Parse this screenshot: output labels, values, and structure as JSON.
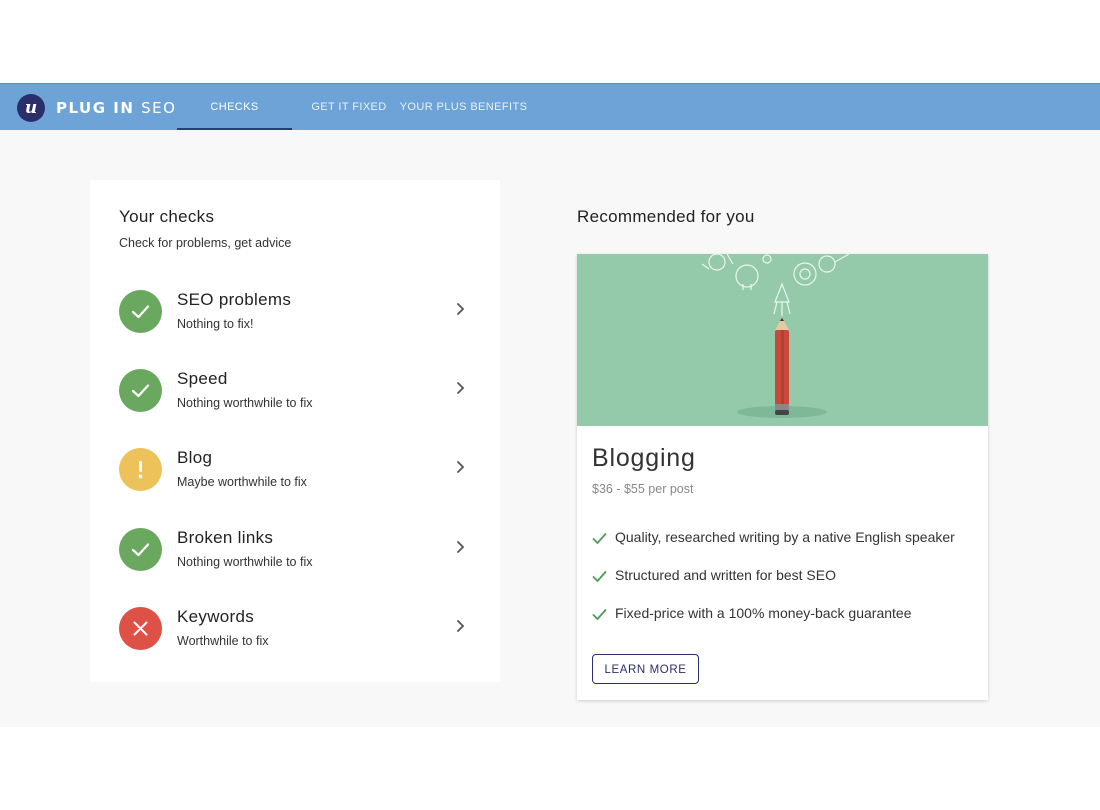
{
  "brand": {
    "logo_letter": "u",
    "name_bold": "PLUG IN",
    "name_light": "SEO",
    "color": "#2a2f6b"
  },
  "nav": {
    "bar_color": "#6da3d6",
    "tabs": [
      {
        "label": "CHECKS",
        "active": true
      },
      {
        "label": "GET IT FIXED",
        "active": false
      },
      {
        "label": "YOUR PLUS BENEFITS",
        "active": false
      }
    ]
  },
  "checks": {
    "title": "Your checks",
    "subtitle": "Check for problems, get advice",
    "items": [
      {
        "title": "SEO problems",
        "status_text": "Nothing to fix!",
        "status": "ok",
        "icon": "check-icon",
        "color": "#6aa85f"
      },
      {
        "title": "Speed",
        "status_text": "Nothing worthwhile to fix",
        "status": "ok",
        "icon": "check-icon",
        "color": "#6aa85f"
      },
      {
        "title": "Blog",
        "status_text": "Maybe worthwhile to fix",
        "status": "warning",
        "icon": "exclamation-icon",
        "color": "#eec25a"
      },
      {
        "title": "Broken links",
        "status_text": "Nothing worthwhile to fix",
        "status": "ok",
        "icon": "check-icon",
        "color": "#6aa85f"
      },
      {
        "title": "Keywords",
        "status_text": "Worthwhile to fix",
        "status": "error",
        "icon": "x-icon",
        "color": "#dd5146"
      }
    ]
  },
  "recommended": {
    "heading": "Recommended for you",
    "card": {
      "title": "Blogging",
      "price": "$36 - $55 per post",
      "features": [
        "Quality, researched writing by a native English speaker",
        "Structured and written for best SEO",
        "Fixed-price with a 100% money-back guarantee"
      ],
      "button_label": "LEARN MORE",
      "hero_color": "#94c9a9"
    }
  }
}
